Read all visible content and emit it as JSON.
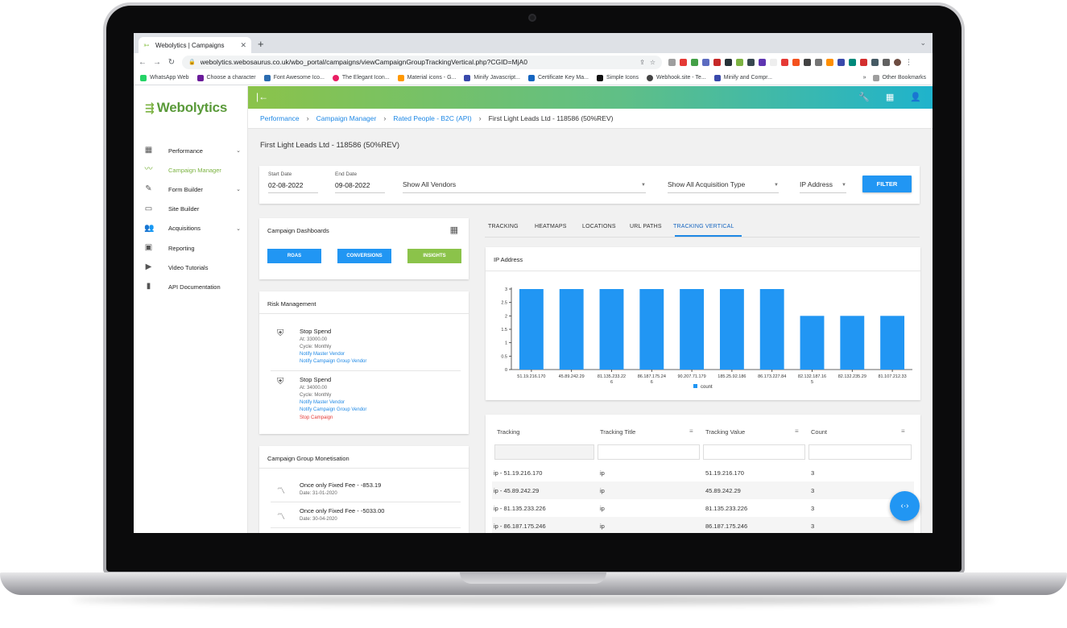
{
  "browser": {
    "tab_title": "Webolytics | Campaigns",
    "url": "webolytics.webosaurus.co.uk/wbo_portal/campaigns/viewCampaignGroupTrackingVertical.php?CGID=MjA0",
    "bookmarks": [
      {
        "label": "WhatsApp Web",
        "color": "#25d366"
      },
      {
        "label": "Choose a character",
        "color": "#6a1b9a"
      },
      {
        "label": "Font Awesome Ico...",
        "color": "#2b6cb0"
      },
      {
        "label": "The Elegant Icon...",
        "color": "#e91e63"
      },
      {
        "label": "Material icons - G...",
        "color": "#ff9800"
      },
      {
        "label": "Minify Javascript...",
        "color": "#3949ab"
      },
      {
        "label": "Certificate Key Ma...",
        "color": "#1565c0"
      },
      {
        "label": "Simple Icons",
        "color": "#111111"
      },
      {
        "label": "Webhook.site - Te...",
        "color": "#444444"
      },
      {
        "label": "Minify and Compr...",
        "color": "#3949ab"
      }
    ],
    "other_bookmarks": "Other Bookmarks",
    "more": "»"
  },
  "app": {
    "logo": "Webolytics",
    "nav": [
      {
        "label": "Performance",
        "icon": "dashboard-icon",
        "glyph": "▦",
        "chevron": true,
        "active": false
      },
      {
        "label": "Campaign Manager",
        "icon": "trending-icon",
        "glyph": "〰",
        "chevron": false,
        "active": true
      },
      {
        "label": "Form Builder",
        "icon": "form-icon",
        "glyph": "✎",
        "chevron": true,
        "active": false
      },
      {
        "label": "Site Builder",
        "icon": "web-icon",
        "glyph": "▭",
        "chevron": false,
        "active": false
      },
      {
        "label": "Acquisitions",
        "icon": "people-icon",
        "glyph": "👥",
        "chevron": true,
        "active": false
      },
      {
        "label": "Reporting",
        "icon": "report-icon",
        "glyph": "▣",
        "chevron": false,
        "active": false
      },
      {
        "label": "Video Tutorials",
        "icon": "video-icon",
        "glyph": "▶",
        "chevron": false,
        "active": false
      },
      {
        "label": "API Documentation",
        "icon": "book-icon",
        "glyph": "▮",
        "chevron": false,
        "active": false
      }
    ],
    "breadcrumbs": [
      "Performance",
      "Campaign Manager",
      "Rated People - B2C (API)"
    ],
    "breadcrumb_current": "First Light Leads Ltd - 118586 (50%REV)",
    "page_title": "First Light Leads Ltd - 118586 (50%REV)"
  },
  "filters": {
    "start_label": "Start Date",
    "start_value": "02-08-2022",
    "end_label": "End Date",
    "end_value": "09-08-2022",
    "vendors": "Show All Vendors",
    "acquisition": "Show All Acquisition Type",
    "ip": "IP Address",
    "button": "FILTER"
  },
  "dashboards": {
    "title": "Campaign Dashboards",
    "buttons": [
      "ROAS",
      "CONVERSIONS",
      "INSIGHTS"
    ]
  },
  "risk": {
    "title": "Risk Management",
    "items": [
      {
        "title": "Stop Spend",
        "at": "At: 33000.00",
        "cycle": "Cycle: Monthly",
        "links": [
          "Notify Master Vendor",
          "Notify Campaign Group Vendor"
        ],
        "stop": ""
      },
      {
        "title": "Stop Spend",
        "at": "At: 34000.00",
        "cycle": "Cycle: Monthly",
        "links": [
          "Notify Master Vendor",
          "Notify Campaign Group Vendor"
        ],
        "stop": "Stop Campaign"
      }
    ]
  },
  "monetisation": {
    "title": "Campaign Group Monetisation",
    "items": [
      {
        "title": "Once only Fixed Fee - -853.19",
        "date": "Date: 31-01-2020"
      },
      {
        "title": "Once only Fixed Fee - -5033.00",
        "date": "Date: 30-04-2020"
      }
    ]
  },
  "tabs": [
    "TRACKING",
    "HEATMAPS",
    "LOCATIONS",
    "URL PATHS",
    "TRACKING VERTICAL"
  ],
  "chart_title": "IP Address",
  "chart_data": {
    "type": "bar",
    "title": "IP Address",
    "categories": [
      "51.19.216.170",
      "45.89.242.29",
      "81.135.233.226",
      "86.187.175.246",
      "90.207.71.179",
      "185.25.92.186",
      "86.173.227.84",
      "82.132.187.165",
      "82.132.235.29",
      "81.107.212.33"
    ],
    "tick_labels": [
      [
        "51.19.216.170"
      ],
      [
        "45.89.242.29"
      ],
      [
        "81.135.233.22",
        "6"
      ],
      [
        "86.187.175.24",
        "6"
      ],
      [
        "90.207.71.179"
      ],
      [
        "185.25.92.186"
      ],
      [
        "86.173.227.84"
      ],
      [
        "82.132.187.16",
        "5"
      ],
      [
        "82.132.235.29"
      ],
      [
        "81.107.212.33"
      ]
    ],
    "series": [
      {
        "name": "count",
        "values": [
          3,
          3,
          3,
          3,
          3,
          3,
          3,
          2,
          2,
          2
        ],
        "color": "#2196f3"
      }
    ],
    "yticks": [
      "0",
      "0.5",
      "1",
      "1.5",
      "2",
      "2.5",
      "3"
    ],
    "ylim": [
      0,
      3
    ],
    "legend": "bottom-center",
    "grid": false
  },
  "table": {
    "headers": [
      "Tracking",
      "Tracking Title",
      "Tracking Value",
      "Count"
    ],
    "rows": [
      [
        "ip - 51.19.216.170",
        "ip",
        "51.19.216.170",
        "3"
      ],
      [
        "ip - 45.89.242.29",
        "ip",
        "45.89.242.29",
        "3"
      ],
      [
        "ip - 81.135.233.226",
        "ip",
        "81.135.233.226",
        "3"
      ],
      [
        "ip - 86.187.175.246",
        "ip",
        "86.187.175.246",
        "3"
      ]
    ]
  },
  "fab_glyph": "‹·›",
  "colors": {
    "accent_green": "#7cb342",
    "primary_blue": "#2196f3",
    "insights_green": "#8bc34a",
    "stop_red": "#e53935"
  }
}
